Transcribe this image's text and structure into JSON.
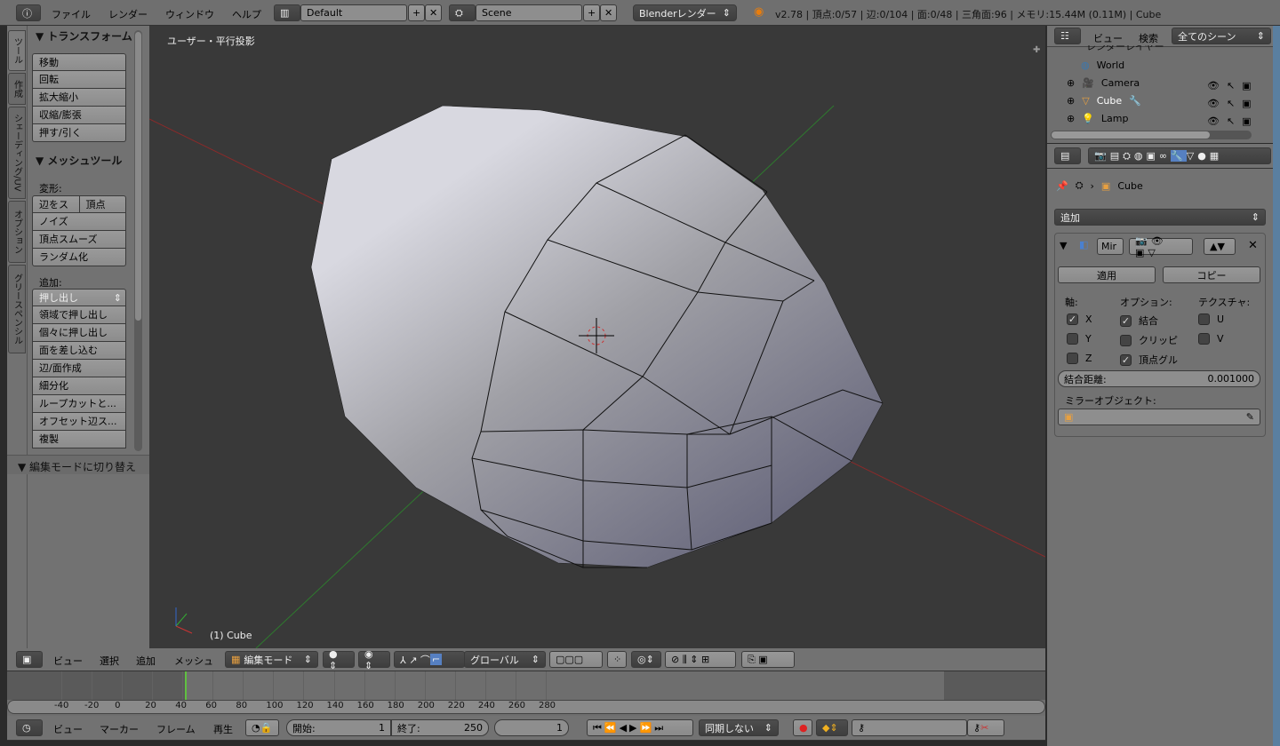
{
  "topbar": {
    "menus": [
      "ファイル",
      "レンダー",
      "ウィンドウ",
      "ヘルプ"
    ],
    "layout": "Default",
    "scene": "Scene",
    "engine": "Blenderレンダー",
    "stats": "v2.78 | 頂点:0/57 | 辺:0/104 | 面:0/48 | 三角面:96 | メモリ:15.44M (0.11M) | Cube"
  },
  "toolshelf": {
    "tabs": [
      "ツール",
      "作成",
      "シェーディング/UV",
      "オプション",
      "グリースペンシル"
    ],
    "transform_title": "▼ トランスフォーム",
    "transform": [
      "移動",
      "回転",
      "拡大縮小",
      "収縮/膨張",
      "押す/引く"
    ],
    "mesh_title": "▼ メッシュツール",
    "deform_label": "変形:",
    "deform_pair": [
      "辺をス",
      "頂点"
    ],
    "deform": [
      "ノイズ",
      "頂点スムーズ",
      "ランダム化"
    ],
    "add_label": "追加:",
    "extrude": "押し出し",
    "add": [
      "領域で押し出し",
      "個々に押し出し",
      "面を差し込む",
      "辺/面作成",
      "細分化",
      "ループカットと...",
      "オフセット辺ス...",
      "複製"
    ],
    "edit_toggle": "▼ 編集モードに切り替え"
  },
  "viewport": {
    "view_label": "ユーザー・平行投影",
    "object_label": "(1) Cube"
  },
  "viewport_header": {
    "menus": [
      "ビュー",
      "選択",
      "追加",
      "メッシュ"
    ],
    "mode": "編集モード",
    "orientation": "グローバル"
  },
  "timeline": {
    "ticks": [
      "-40",
      "-20",
      "0",
      "20",
      "40",
      "60",
      "80",
      "100",
      "120",
      "140",
      "160",
      "180",
      "200",
      "220",
      "240",
      "260",
      "280"
    ],
    "current_frame": 1,
    "menus": [
      "ビュー",
      "マーカー",
      "フレーム",
      "再生"
    ],
    "start_label": "開始:",
    "start": "1",
    "end_label": "終了:",
    "end": "250",
    "frame": "1",
    "sync": "同期しない"
  },
  "outliner": {
    "menus": [
      "ビュー",
      "検索"
    ],
    "filter": "全てのシーン",
    "partial": "レンダーレイヤー",
    "items": [
      "World",
      "Camera",
      "Cube",
      "Lamp"
    ]
  },
  "properties": {
    "breadcrumb": "Cube",
    "add_modifier": "追加",
    "modifier_name": "Mir",
    "apply": "適用",
    "copy": "コピー",
    "axis_label": "軸:",
    "options_label": "オプション:",
    "texture_label": "テクスチャ:",
    "axis": [
      {
        "label": "X",
        "checked": true
      },
      {
        "label": "Y",
        "checked": false
      },
      {
        "label": "Z",
        "checked": false
      }
    ],
    "options": [
      {
        "label": "結合",
        "checked": true
      },
      {
        "label": "クリッピ",
        "checked": false
      },
      {
        "label": "頂点グル",
        "checked": true
      }
    ],
    "texture": [
      {
        "label": "U",
        "checked": false
      },
      {
        "label": "V",
        "checked": false
      }
    ],
    "merge_label": "結合距離:",
    "merge_value": "0.001000",
    "mirror_object_label": "ミラーオブジェクト:"
  },
  "colors": {
    "accent": "#5680c2",
    "viewport_bg": "#393939",
    "frame_line": "#60c040"
  }
}
